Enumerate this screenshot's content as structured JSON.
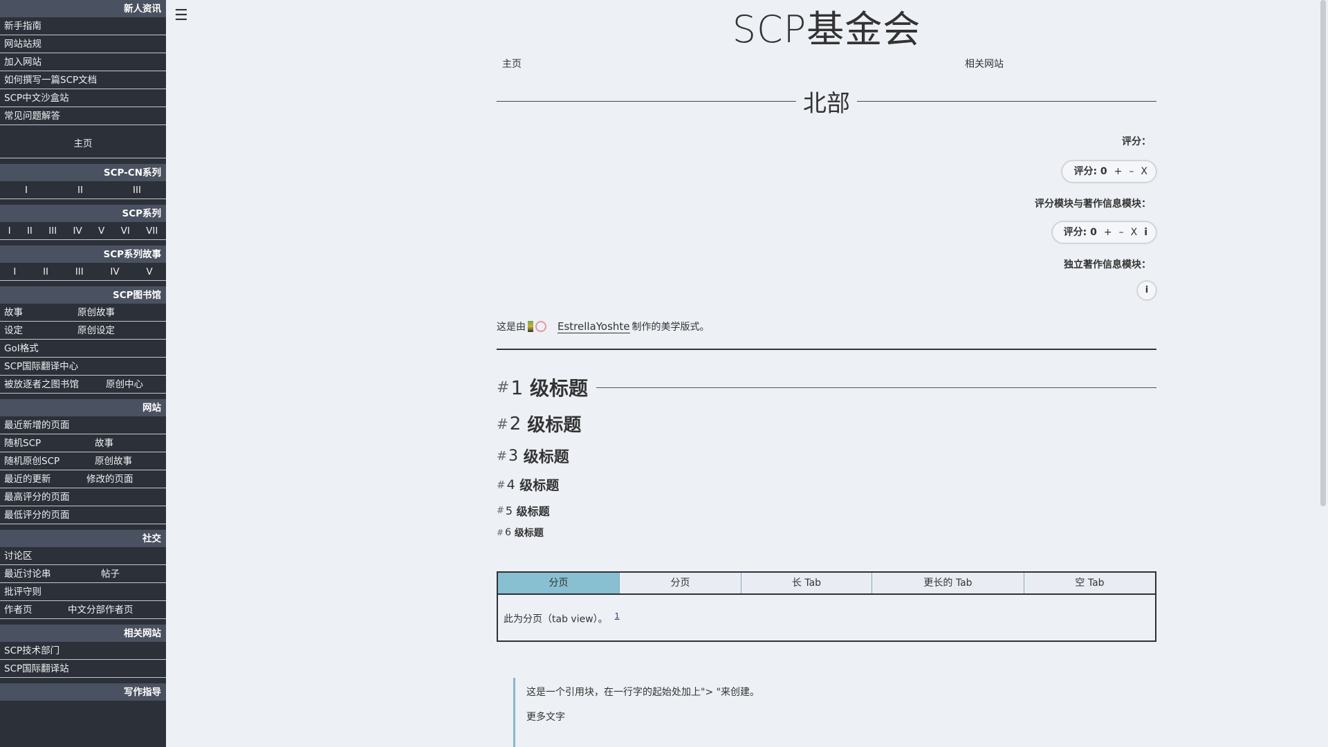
{
  "sidebar": {
    "sections": [
      {
        "head": "新人资讯",
        "items": [
          [
            "新手指南"
          ],
          [
            "网站站规"
          ],
          [
            "加入网站"
          ],
          [
            "如何撰写一篇SCP文档"
          ],
          [
            "SCP中文沙盒站"
          ],
          [
            "常见问题解答"
          ]
        ]
      },
      {
        "head": "",
        "main": "主页"
      },
      {
        "head": "SCP-CN系列",
        "spread": [
          "I",
          "II",
          "III"
        ]
      },
      {
        "head": "SCP系列",
        "spread": [
          "I",
          "II",
          "III",
          "IV",
          "V",
          "VI",
          "VII"
        ]
      },
      {
        "head": "SCP系列故事",
        "spread": [
          "I",
          "II",
          "III",
          "IV",
          "V"
        ]
      },
      {
        "head": "SCP图书馆",
        "items": [
          [
            "故事",
            "原创故事"
          ],
          [
            "设定",
            "原创设定"
          ],
          [
            "GoI格式"
          ],
          [
            "SCP国际翻译中心"
          ],
          [
            "被放逐者之图书馆",
            "原创中心"
          ]
        ]
      },
      {
        "head": "网站",
        "items": [
          [
            "最近新增的页面"
          ],
          [
            "随机SCP",
            "故事"
          ],
          [
            "随机原创SCP",
            "原创故事"
          ],
          [
            "最近的更新",
            "修改的页面"
          ],
          [
            "最高评分的页面"
          ],
          [
            "最低评分的页面"
          ]
        ]
      },
      {
        "head": "社交",
        "items": [
          [
            "讨论区"
          ],
          [
            "最近讨论串",
            "帖子"
          ],
          [
            "批评守则"
          ],
          [
            "作者页",
            "中文分部作者页"
          ]
        ]
      },
      {
        "head": "相关网站",
        "items": [
          [
            "SCP技术部门"
          ],
          [
            "SCP国际翻译站"
          ]
        ]
      },
      {
        "head": "写作指导",
        "items": []
      }
    ]
  },
  "header": {
    "site_title": "SCP基金会",
    "nav_home": "主页",
    "nav_related": "相关网站"
  },
  "page": {
    "title": "北部",
    "rating_label": "评分：",
    "rating_box_1": {
      "label": "评分: 0",
      "plus": "+",
      "minus": "–",
      "cancel": "X"
    },
    "rating_author_label": "评分模块与著作信息模块：",
    "rating_box_2": {
      "label": "评分: 0",
      "plus": "+",
      "minus": "–",
      "cancel": "X",
      "info": "i"
    },
    "author_info_label": "独立著作信息模块：",
    "author_info_btn": "i",
    "credit_prefix": "这是由",
    "credit_author": "EstrellaYoshte",
    "credit_suffix": "制作的美学版式。",
    "headings": [
      {
        "hash": "#",
        "num": "1",
        "text": "级标题"
      },
      {
        "hash": "#",
        "num": "2",
        "text": "级标题"
      },
      {
        "hash": "#",
        "num": "3",
        "text": "级标题"
      },
      {
        "hash": "#",
        "num": "4",
        "text": "级标题"
      },
      {
        "hash": "#",
        "num": "5",
        "text": "级标题"
      },
      {
        "hash": "#",
        "num": "6",
        "text": "级标题"
      }
    ],
    "tabs": [
      "分页",
      "分页",
      "长 Tab",
      "更长的 Tab",
      "空 Tab"
    ],
    "tab_body": "此为分页（tab view）。",
    "tab_footnote": "1",
    "quote_line1": "这是一个引用块，在一行字的起始处加上\"> \"来创建。",
    "quote_line2": "更多文字"
  },
  "icons": {
    "menu": "hamburger-icon"
  }
}
